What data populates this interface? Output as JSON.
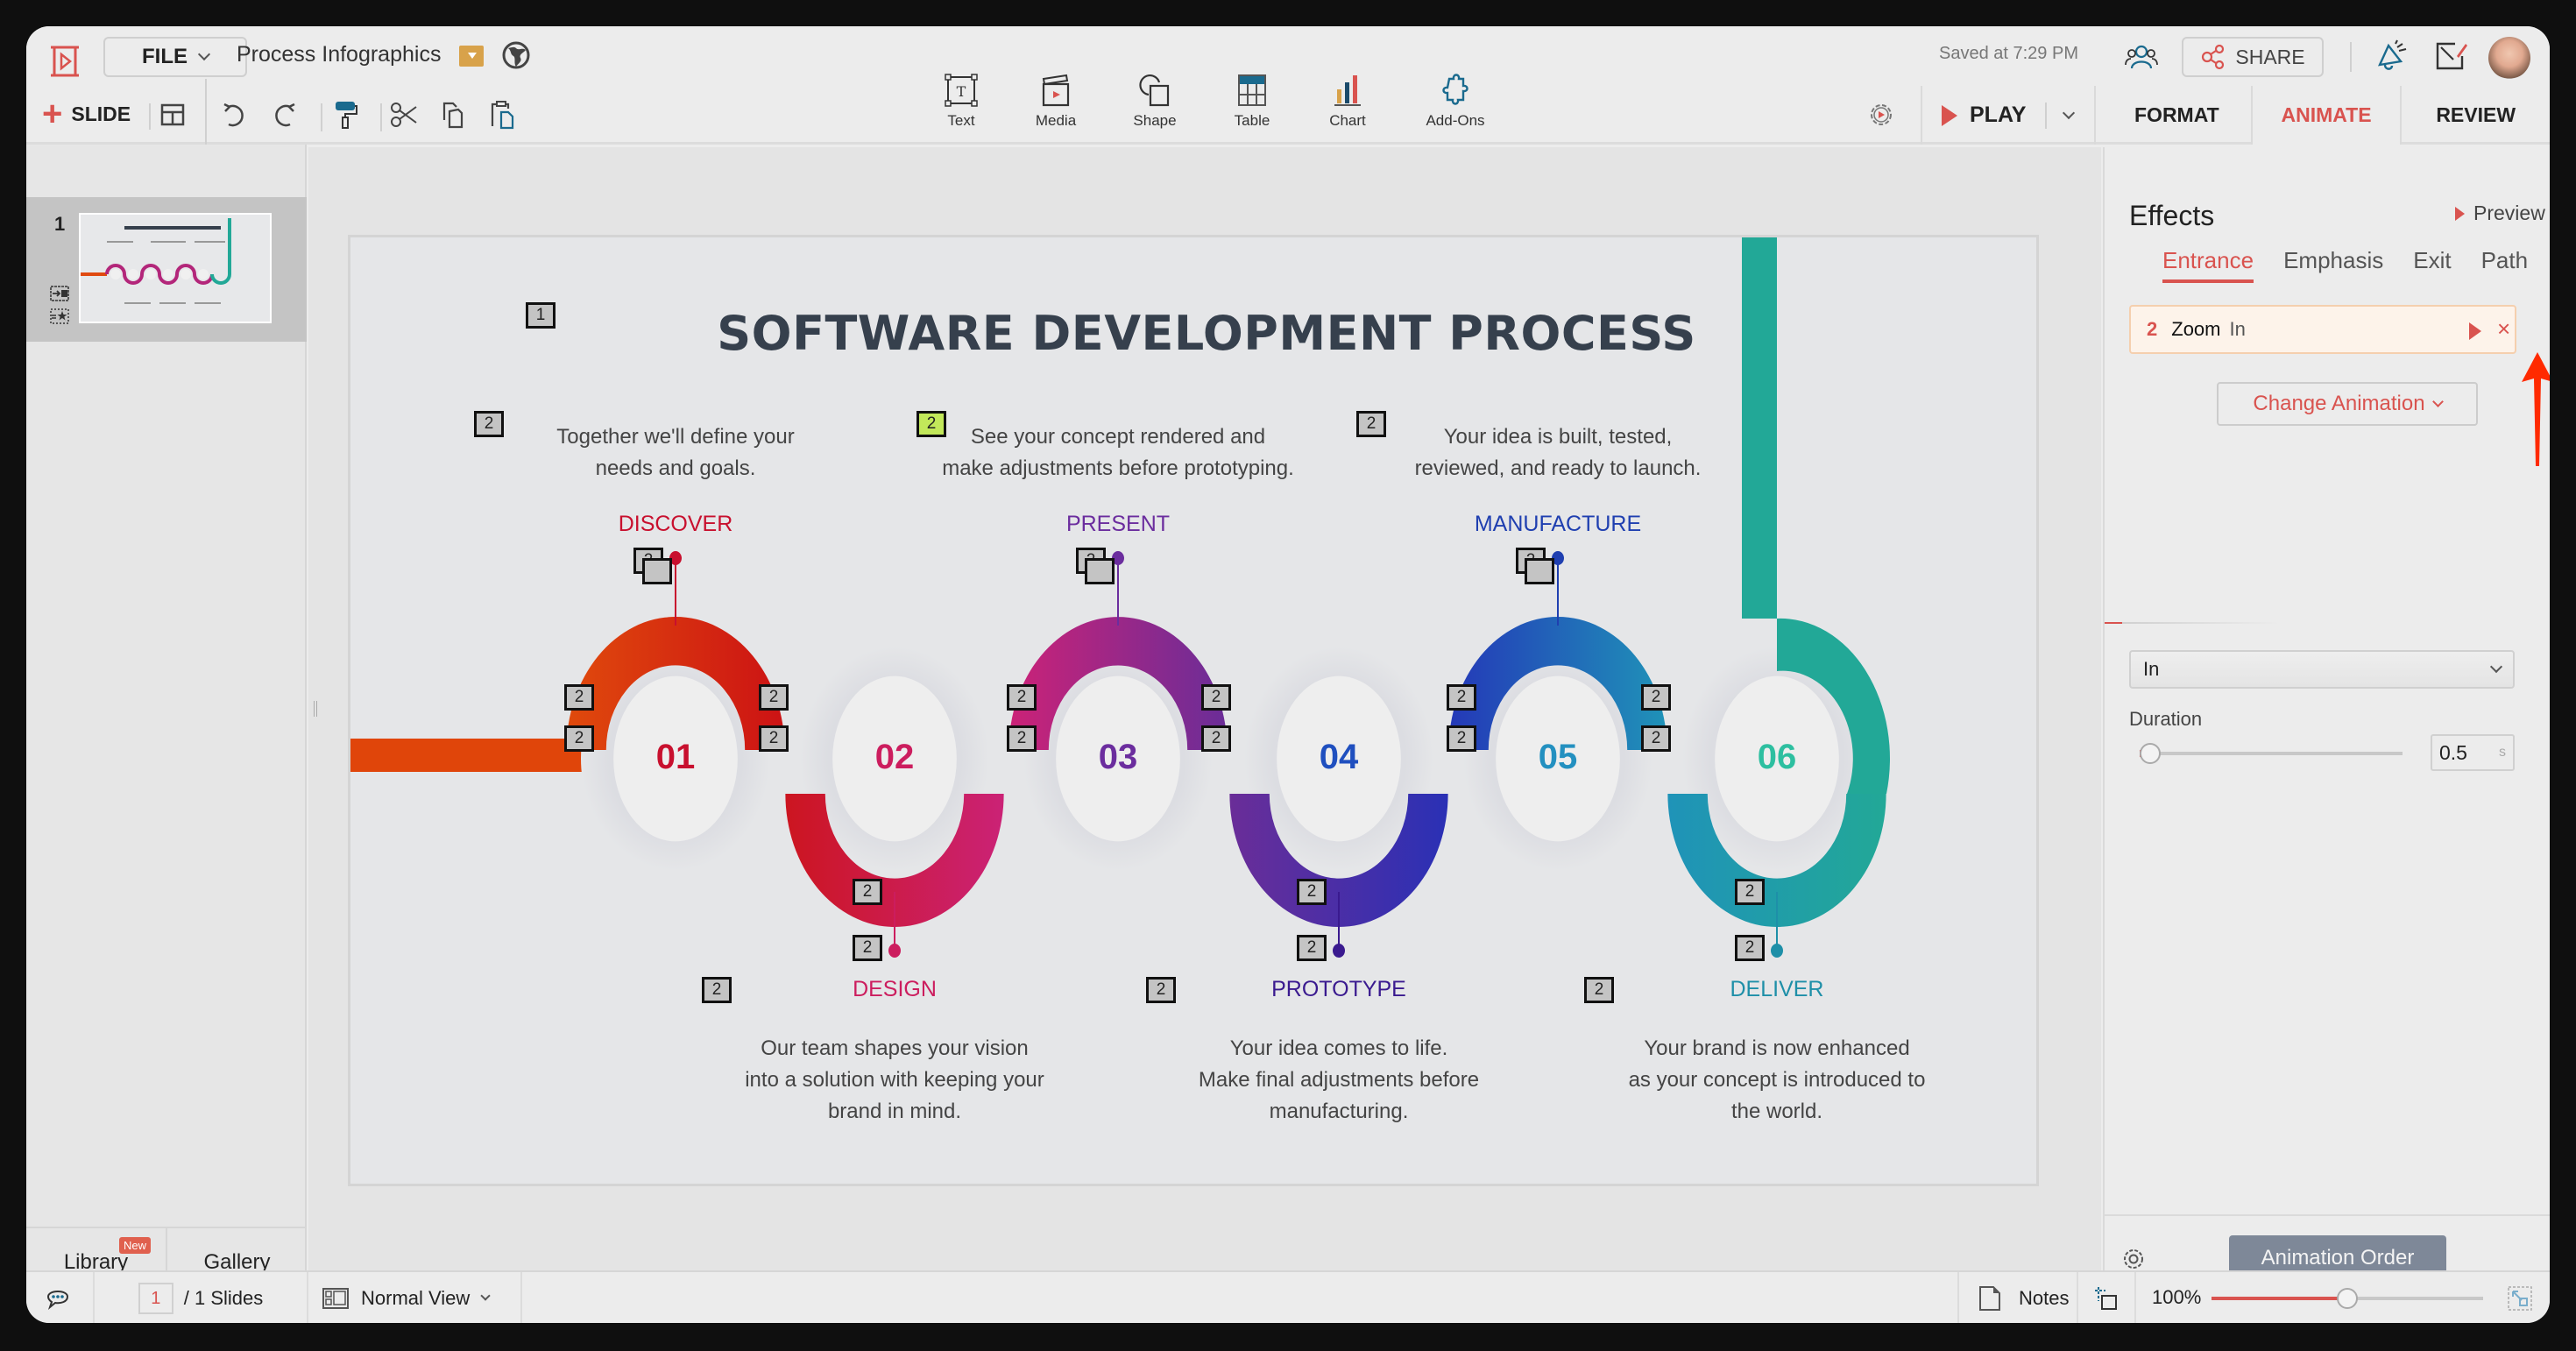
{
  "app": {
    "file_label": "FILE",
    "document_title": "Process Infographics",
    "saved_status": "Saved at 7:29 PM",
    "share_label": "SHARE",
    "slide_label": "SLIDE",
    "play_label": "PLAY"
  },
  "insert_toolbar": [
    {
      "label": "Text",
      "icon": "text-box-icon"
    },
    {
      "label": "Media",
      "icon": "clapperboard-icon"
    },
    {
      "label": "Shape",
      "icon": "shape-icon"
    },
    {
      "label": "Table",
      "icon": "table-icon"
    },
    {
      "label": "Chart",
      "icon": "bar-chart-icon"
    },
    {
      "label": "Add-Ons",
      "icon": "puzzle-icon"
    }
  ],
  "right_tabs": [
    {
      "label": "FORMAT",
      "active": false
    },
    {
      "label": "ANIMATE",
      "active": true
    },
    {
      "label": "REVIEW",
      "active": false
    }
  ],
  "left_panel": {
    "slide_number": "1",
    "library_label": "Library",
    "new_badge": "New",
    "gallery_label": "Gallery"
  },
  "slide": {
    "title": "SOFTWARE DEVELOPMENT PROCESS",
    "title_anim_order": "1",
    "steps": [
      {
        "number": "01",
        "label": "DISCOVER",
        "description": [
          "Together we'll define your",
          "needs and goals."
        ],
        "color": "#c8102e",
        "position": "top"
      },
      {
        "number": "02",
        "label": "DESIGN",
        "description": [
          "Our team shapes your vision",
          "into a solution with keeping your",
          "brand in mind."
        ],
        "color": "#cc1d5e",
        "position": "bottom"
      },
      {
        "number": "03",
        "label": "PRESENT",
        "description": [
          "See your concept rendered and",
          "make adjustments before prototyping."
        ],
        "color": "#6b2d9e",
        "position": "top"
      },
      {
        "number": "04",
        "label": "PROTOTYPE",
        "description": [
          "Your idea comes to life.",
          "Make final adjustments before",
          "manufacturing."
        ],
        "color": "#3a1a8f",
        "position": "bottom"
      },
      {
        "number": "05",
        "label": "MANUFACTURE",
        "description": [
          "Your idea is built, tested,",
          "reviewed, and ready to launch."
        ],
        "color": "#1f3fb0",
        "position": "top"
      },
      {
        "number": "06",
        "label": "DELIVER",
        "description": [
          "Your brand is now enhanced",
          "as your concept is introduced to",
          "the world."
        ],
        "color": "#1e8fa8",
        "position": "bottom"
      }
    ],
    "number_colors": [
      "#c8102e",
      "#cc1d5e",
      "#6b2d9e",
      "#1f4fbf",
      "#2390c0",
      "#2dbfa0"
    ],
    "anim_tag_label": "2"
  },
  "effects_panel": {
    "heading": "Effects",
    "preview_label": "Preview",
    "tabs": [
      {
        "label": "Entrance",
        "active": true
      },
      {
        "label": "Emphasis",
        "active": false
      },
      {
        "label": "Exit",
        "active": false
      },
      {
        "label": "Path",
        "active": false
      }
    ],
    "animation_item": {
      "order": "2",
      "effect": "Zoom",
      "direction": "In"
    },
    "change_animation_label": "Change Animation",
    "direction_value": "In",
    "duration_label": "Duration",
    "duration_value": "0.5",
    "duration_unit": "s",
    "duration_fraction": 0.02,
    "animation_order_label": "Animation Order"
  },
  "status_bar": {
    "current_page": "1",
    "total_pages": "/ 1 Slides",
    "view_mode": "Normal View",
    "notes_label": "Notes",
    "zoom_level": "100%",
    "zoom_fraction": 0.5
  },
  "colors": {
    "accent": "#d9534f",
    "selected_anim_tag": "#c2e85a",
    "anim_order_button": "#7e8898"
  }
}
